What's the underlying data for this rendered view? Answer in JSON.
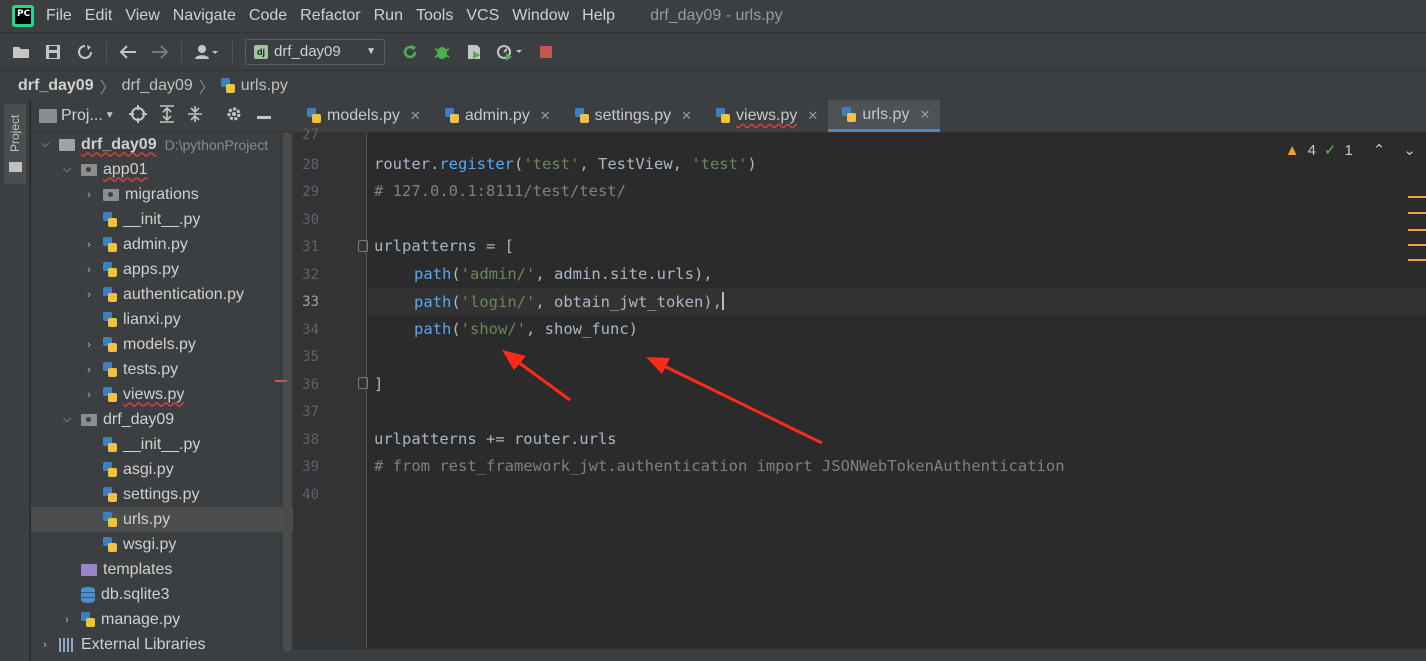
{
  "menubar": {
    "items": [
      "File",
      "Edit",
      "View",
      "Navigate",
      "Code",
      "Refactor",
      "Run",
      "Tools",
      "VCS",
      "Window",
      "Help"
    ],
    "window_title": "drf_day09 - urls.py"
  },
  "toolbar": {
    "run_config": "drf_day09",
    "icons": [
      "open-icon",
      "save-icon",
      "sync-icon",
      "back-icon",
      "forward-icon",
      "user-icon",
      "run-icon",
      "debug-icon",
      "coverage-icon",
      "profile-icon",
      "stop-icon"
    ],
    "run_color": "#4caf50",
    "stop_color": "#c75450"
  },
  "breadcrumbs": [
    "drf_day09",
    "drf_day09",
    "urls.py"
  ],
  "stripe": {
    "label": "Project"
  },
  "project": {
    "header_label": "Proj...",
    "root_name": "drf_day09",
    "root_path": "D:\\pythonProject",
    "tree": [
      {
        "name": "app01",
        "kind": "folder-pkg",
        "depth": 1,
        "expanded": true
      },
      {
        "name": "migrations",
        "kind": "folder-pkg",
        "depth": 2,
        "collapsed": true
      },
      {
        "name": "__init__.py",
        "kind": "py",
        "depth": 2
      },
      {
        "name": "admin.py",
        "kind": "py",
        "depth": 2,
        "collapsed": true
      },
      {
        "name": "apps.py",
        "kind": "py",
        "depth": 2,
        "collapsed": true
      },
      {
        "name": "authentication.py",
        "kind": "py",
        "depth": 2,
        "collapsed": true
      },
      {
        "name": "lianxi.py",
        "kind": "py",
        "depth": 2
      },
      {
        "name": "models.py",
        "kind": "py",
        "depth": 2,
        "collapsed": true
      },
      {
        "name": "tests.py",
        "kind": "py",
        "depth": 2,
        "collapsed": true
      },
      {
        "name": "views.py",
        "kind": "py",
        "depth": 2,
        "collapsed": true
      },
      {
        "name": "drf_day09",
        "kind": "folder-pkg",
        "depth": 1,
        "expanded": true
      },
      {
        "name": "__init__.py",
        "kind": "py",
        "depth": 2
      },
      {
        "name": "asgi.py",
        "kind": "py",
        "depth": 2
      },
      {
        "name": "settings.py",
        "kind": "py",
        "depth": 2
      },
      {
        "name": "urls.py",
        "kind": "py",
        "depth": 2,
        "selected": true
      },
      {
        "name": "wsgi.py",
        "kind": "py",
        "depth": 2
      },
      {
        "name": "templates",
        "kind": "folder-purple",
        "depth": 1
      },
      {
        "name": "db.sqlite3",
        "kind": "db",
        "depth": 1
      },
      {
        "name": "manage.py",
        "kind": "py",
        "depth": 1,
        "collapsed": true
      },
      {
        "name": "External Libraries",
        "kind": "libs",
        "depth": 0,
        "collapsed": true
      }
    ]
  },
  "tabs": [
    {
      "label": "models.py",
      "active": false
    },
    {
      "label": "admin.py",
      "active": false
    },
    {
      "label": "settings.py",
      "active": false
    },
    {
      "label": "views.py",
      "active": false
    },
    {
      "label": "urls.py",
      "active": true
    }
  ],
  "inspections": {
    "warnings": "4",
    "ok": "1"
  },
  "editor": {
    "line_numbers": [
      "27",
      "28",
      "29",
      "30",
      "31",
      "32",
      "33",
      "34",
      "35",
      "36",
      "37",
      "38",
      "39",
      "40"
    ],
    "lines": {
      "l28_a": "router.",
      "l28_fn": "register",
      "l28_b": "(",
      "l28_s1": "'test'",
      "l28_c": ", TestView, ",
      "l28_s2": "'test'",
      "l28_d": ")",
      "l29": "# 127.0.0.1:8111/test/test/",
      "l31": "urlpatterns = [",
      "l32_fn": "path",
      "l32_a": "(",
      "l32_s": "'admin/'",
      "l32_b": ", admin.site.urls),",
      "l33_fn": "path",
      "l33_a": "(",
      "l33_s": "'login/'",
      "l33_b": ", obtain_jwt_token),",
      "l34_fn": "path",
      "l34_a": "(",
      "l34_s": "'show/'",
      "l34_b": ", show_func)",
      "l36": "]",
      "l38": "urlpatterns += router.urls",
      "l39": "# from rest_framework_jwt.authentication import JSONWebTokenAuthentication"
    }
  },
  "annotation_color": "#ff2a1a"
}
